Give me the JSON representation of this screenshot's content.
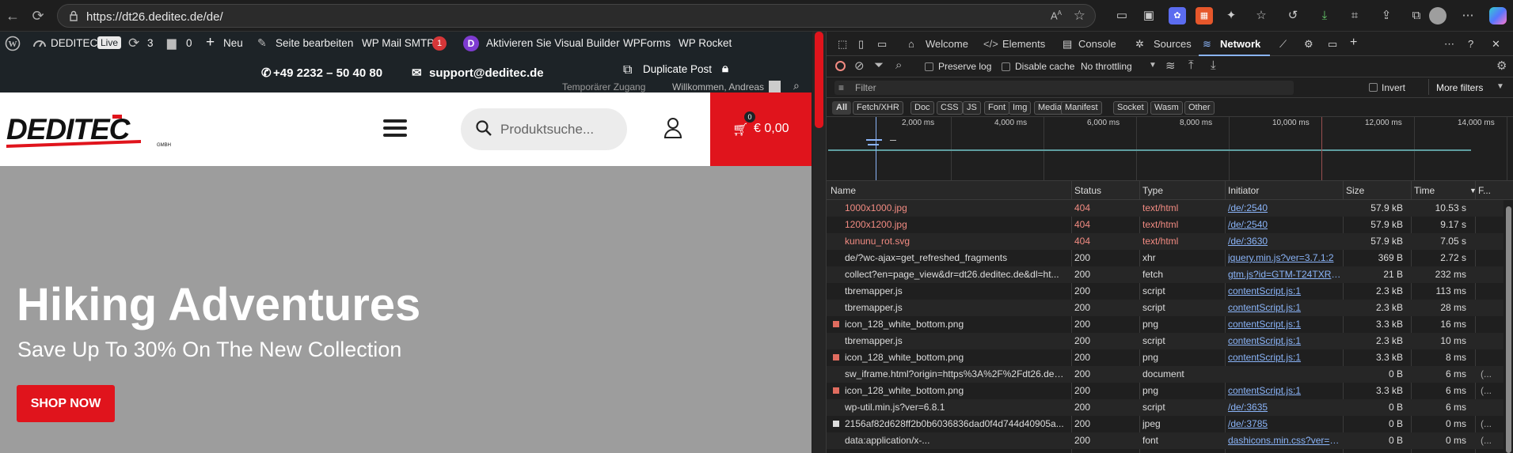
{
  "browser": {
    "url": "https://dt26.deditec.de/de/"
  },
  "wpbar": {
    "site": "DEDITEC",
    "live": "Live",
    "updates": "3",
    "comments": "0",
    "new": "Neu",
    "edit": "Seite bearbeiten",
    "smtp": "WP Mail SMTP",
    "smtp_count": "1",
    "divi": "Aktivieren Sie Visual Builder",
    "wpforms": "WPForms",
    "rocket": "WP Rocket"
  },
  "topbar": {
    "phone": "+49 2232 – 50 40 80",
    "email": "support@deditec.de",
    "duplicate": "Duplicate Post",
    "temp": "Temporärer Zugang",
    "welcome": "Willkommen, Andreas"
  },
  "header": {
    "logo": "DEDITEC",
    "logo_sub": "GMBH",
    "search_placeholder": "Produktsuche...",
    "cart_count": "0",
    "cart_total": "€ 0,00"
  },
  "hero": {
    "title": "Hiking Adventures",
    "subtitle": "Save Up To 30% On The New Collection",
    "button": "SHOP NOW"
  },
  "devtools": {
    "tabs": [
      "Welcome",
      "Elements",
      "Console",
      "Sources",
      "Network"
    ],
    "preserve_log": "Preserve log",
    "disable_cache": "Disable cache",
    "throttling": "No throttling",
    "filter_placeholder": "Filter",
    "invert": "Invert",
    "more_filters": "More filters",
    "types": [
      "All",
      "Fetch/XHR",
      "Doc",
      "CSS",
      "JS",
      "Font",
      "Img",
      "Media",
      "Manifest",
      "Socket",
      "Wasm",
      "Other"
    ],
    "ticks": [
      "2,000 ms",
      "4,000 ms",
      "6,000 ms",
      "8,000 ms",
      "10,000 ms",
      "12,000 ms",
      "14,000 ms"
    ],
    "columns": [
      "Name",
      "Status",
      "Type",
      "Initiator",
      "Size",
      "Time",
      "F..."
    ],
    "rows": [
      {
        "name": "1000x1000.jpg",
        "status": "404",
        "type": "text/html",
        "initiator": "/de/:2540",
        "size": "57.9 kB",
        "time": "10.53 s",
        "err": true,
        "icon": "none"
      },
      {
        "name": "1200x1200.jpg",
        "status": "404",
        "type": "text/html",
        "initiator": "/de/:2540",
        "size": "57.9 kB",
        "time": "9.17 s",
        "err": true,
        "icon": "none"
      },
      {
        "name": "kununu_rot.svg",
        "status": "404",
        "type": "text/html",
        "initiator": "/de/:3630",
        "size": "57.9 kB",
        "time": "7.05 s",
        "err": true,
        "icon": "none"
      },
      {
        "name": "de/?wc-ajax=get_refreshed_fragments",
        "status": "200",
        "type": "xhr",
        "initiator": "jquery.min.js?ver=3.7.1:2",
        "size": "369 B",
        "time": "2.72 s",
        "err": false,
        "icon": "none"
      },
      {
        "name": "collect?en=page_view&dr=dt26.deditec.de&dl=ht...",
        "status": "200",
        "type": "fetch",
        "initiator": "gtm.js?id=GTM-T24TXRC8:101",
        "size": "21 B",
        "time": "232 ms",
        "err": false,
        "icon": "none"
      },
      {
        "name": "tbremapper.js",
        "status": "200",
        "type": "script",
        "initiator": "contentScript.js:1",
        "size": "2.3 kB",
        "time": "113 ms",
        "err": false,
        "icon": "none"
      },
      {
        "name": "tbremapper.js",
        "status": "200",
        "type": "script",
        "initiator": "contentScript.js:1",
        "size": "2.3 kB",
        "time": "28 ms",
        "err": false,
        "icon": "none"
      },
      {
        "name": "icon_128_white_bottom.png",
        "status": "200",
        "type": "png",
        "initiator": "contentScript.js:1",
        "size": "3.3 kB",
        "time": "16 ms",
        "err": false,
        "icon": "img"
      },
      {
        "name": "tbremapper.js",
        "status": "200",
        "type": "script",
        "initiator": "contentScript.js:1",
        "size": "2.3 kB",
        "time": "10 ms",
        "err": false,
        "icon": "none"
      },
      {
        "name": "icon_128_white_bottom.png",
        "status": "200",
        "type": "png",
        "initiator": "contentScript.js:1",
        "size": "3.3 kB",
        "time": "8 ms",
        "err": false,
        "icon": "img"
      },
      {
        "name": "sw_iframe.html?origin=https%3A%2F%2Fdt26.dedi...",
        "status": "200",
        "type": "document",
        "initiator": "",
        "size": "0 B",
        "time": "6 ms",
        "err": false,
        "icon": "none"
      },
      {
        "name": "icon_128_white_bottom.png",
        "status": "200",
        "type": "png",
        "initiator": "contentScript.js:1",
        "size": "3.3 kB",
        "time": "6 ms",
        "err": false,
        "icon": "img"
      },
      {
        "name": "wp-util.min.js?ver=6.8.1",
        "status": "200",
        "type": "script",
        "initiator": "/de/:3635",
        "size": "0 B",
        "time": "6 ms",
        "err": false,
        "icon": "none"
      },
      {
        "name": "2156af82d628ff2b0b6036836dad0f4d744d40905a...",
        "status": "200",
        "type": "jpeg",
        "initiator": "/de/:3785",
        "size": "0 B",
        "time": "0 ms",
        "err": false,
        "icon": "jpeg"
      },
      {
        "name": "data:application/x-...",
        "status": "200",
        "type": "font",
        "initiator": "dashicons.min.css?ver=6.8.1",
        "size": "0 B",
        "time": "0 ms",
        "err": false,
        "icon": "none"
      }
    ]
  }
}
